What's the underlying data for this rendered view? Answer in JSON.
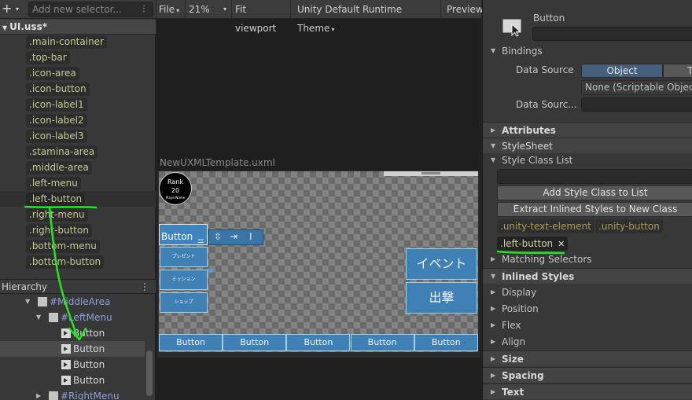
{
  "selectors_panel": {
    "add_button": "+",
    "add_dropdown": "▾",
    "search_placeholder": "Add new selector...",
    "options_icon": "⋮",
    "stylesheet_name": "UI.uss*",
    "selectors": [
      ".main-container",
      ".top-bar",
      ".icon-area",
      ".icon-button",
      ".icon-label1",
      ".icon-label2",
      ".icon-label3",
      ".stamina-area",
      ".middle-area",
      ".left-menu",
      ".left-button",
      ".right-menu",
      ".right-button",
      ".bottom-menu",
      ".bottom-button"
    ]
  },
  "hierarchy": {
    "title": "Hierarchy",
    "menu_icon": "⋮",
    "rows": [
      {
        "label": "#MiddleArea"
      },
      {
        "label": "#LeftMenu"
      },
      {
        "label": "Button"
      },
      {
        "label": "Button"
      },
      {
        "label": "Button"
      },
      {
        "label": "Button"
      },
      {
        "label": "#RightMenu"
      }
    ]
  },
  "viewport_toolbar": {
    "file": "File",
    "zoom": "21%",
    "fit": "Fit viewport",
    "theme": "Unity Default Runtime Theme",
    "preview": "Preview"
  },
  "canvas": {
    "document_title": "NewUXMLTemplate.uxml",
    "rank": {
      "line1": "Rank",
      "line2": "20",
      "line3": "PlayerName"
    },
    "selected_button_label": "Button",
    "left_menu": [
      "プレゼント",
      "ミッション",
      "ショップ"
    ],
    "right_menu": [
      "イベント",
      "出撃"
    ],
    "bottom_menu": [
      "Button",
      "Button",
      "Button",
      "Button",
      "Button"
    ]
  },
  "inspector": {
    "element_type": "Button",
    "bindings_label": "Bindings",
    "data_source_label": "Data Source",
    "seg_object": "Object",
    "seg_other": "T",
    "none_value": "None (Scriptable Object)",
    "data_source_path_label": "Data Sourc...",
    "attributes": "Attributes",
    "stylesheet": "StyleSheet",
    "style_class_list": "Style Class List",
    "add_class_button": "Add Style Class to List",
    "extract_button": "Extract Inlined Styles to New Class",
    "builtin_classes": [
      ".unity-text-element",
      ".unity-button"
    ],
    "user_class": ".left-button",
    "remove_icon": "✕",
    "matching_selectors": "Matching Selectors",
    "inlined_styles": "Inlined Styles",
    "sub_sections": [
      "Display",
      "Position",
      "Flex",
      "Align"
    ],
    "sections": [
      "Size",
      "Spacing",
      "Text"
    ]
  },
  "colors": {
    "annotation_green": "#22e622",
    "ui_blue": "#3f81b4"
  }
}
